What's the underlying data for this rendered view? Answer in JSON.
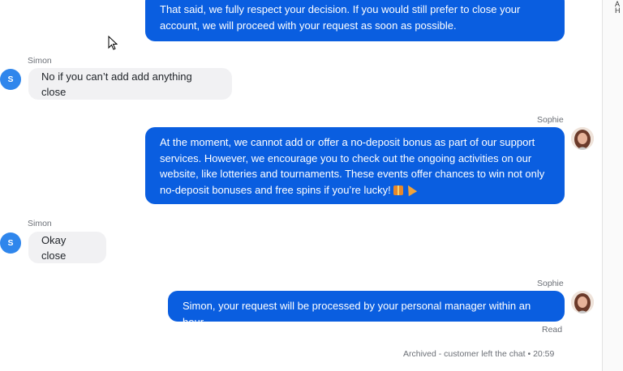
{
  "messages": [
    {
      "sender": "Sophie",
      "text": "That said, we fully respect your decision. If you would still prefer to close your account, we will proceed with your request as soon as possible."
    },
    {
      "sender": "Simon",
      "text": "No if you can’t add add anything close"
    },
    {
      "sender": "Sophie",
      "text": "At the moment, we cannot add or offer a no-deposit bonus as part of our support services. However, we encourage you to check out the ongoing activities on our website, like lotteries and tournaments. These events offer chances to win not only no-deposit bonuses and free spins if you’re lucky!"
    },
    {
      "sender": "Simon",
      "text": "Okay close"
    },
    {
      "sender": "Sophie",
      "text": "Simon, your request will be processed by your personal manager within an hour."
    }
  ],
  "avatar_initial": "S",
  "read_status": "Read",
  "archived_note": "Archived - customer left the chat • 20:59",
  "side_strip": [
    "A",
    "H"
  ],
  "colors": {
    "agent_bubble": "#0a5ee0",
    "user_bubble": "#f1f1f3",
    "avatar": "#2f86ec"
  },
  "icons": [
    "gift-emoji",
    "party-popper-emoji",
    "mouse-cursor-icon"
  ]
}
